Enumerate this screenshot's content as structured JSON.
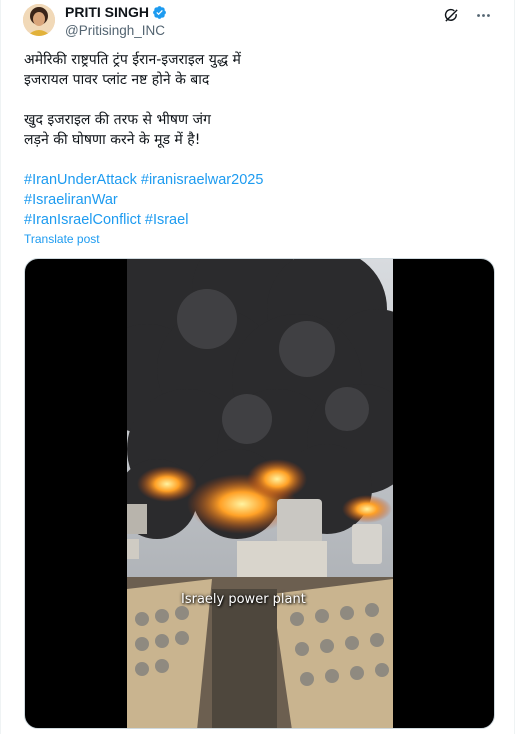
{
  "author": {
    "name": "PRITI SINGH",
    "handle": "@Pritisingh_INC",
    "verified_icon": "verified-badge-icon"
  },
  "actions": {
    "grok_icon": "grok-icon",
    "more_icon": "more-icon"
  },
  "post": {
    "lines": [
      "अमेरिकी राष्ट्रपति ट्रंप ईरान-इजराइल युद्ध में",
      "इजरायल पावर प्लांट नष्ट होने के बाद",
      " खुद इजराइल की तरफ से भीषण जंग",
      "लड़ने की घोषणा करने के मूड में है!"
    ],
    "hashtags": [
      "#IranUnderAttack",
      "#iranisraelwar2025",
      "#IsraeliranWar",
      "#IranIsraelConflict",
      "#Israel"
    ],
    "translate_label": "Translate post"
  },
  "media": {
    "caption": "Israely power plant"
  },
  "colors": {
    "link": "#1d9bf0",
    "text": "#0f1419",
    "muted": "#536471"
  }
}
